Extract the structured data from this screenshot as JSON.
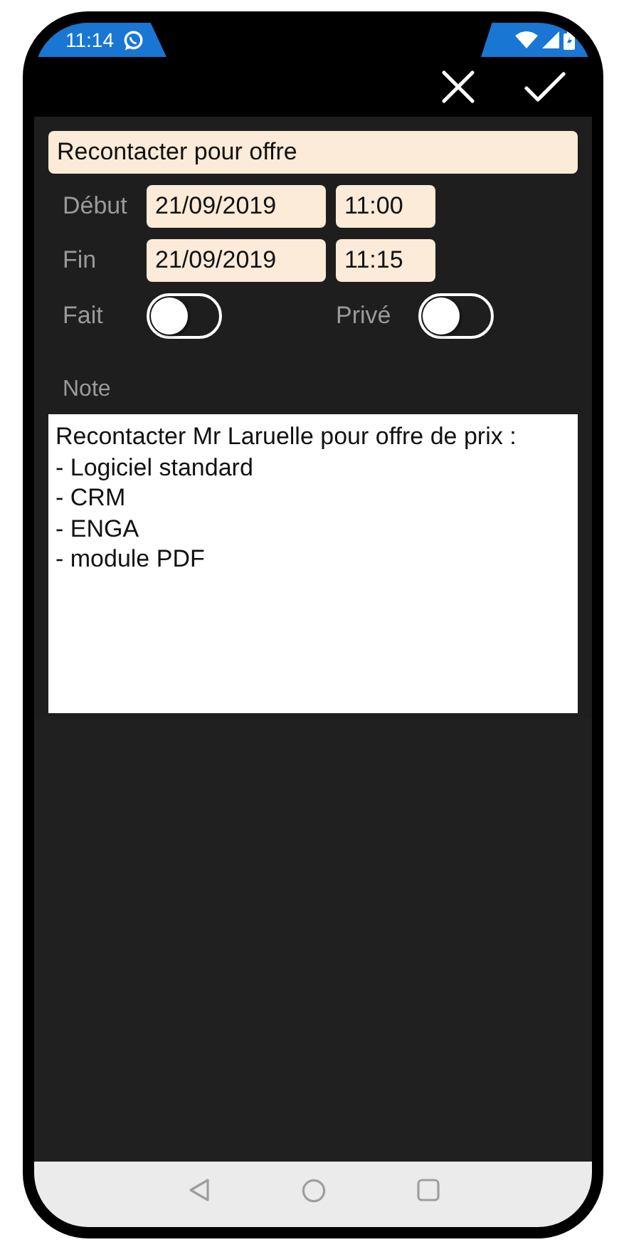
{
  "status_bar": {
    "time": "11:14"
  },
  "title": "Recontacter pour offre",
  "rows": [
    {
      "label": "Début",
      "date": "21/09/2019",
      "time": "11:00"
    },
    {
      "label": "Fin",
      "date": "21/09/2019",
      "time": "11:15"
    }
  ],
  "toggles": [
    {
      "label": "Fait",
      "on": false
    },
    {
      "label": "Privé",
      "on": false
    }
  ],
  "note": {
    "label": "Note",
    "text": "Recontacter Mr Laruelle pour offre de prix :\n- Logiciel standard\n- CRM\n- ENGA\n- module PDF"
  }
}
